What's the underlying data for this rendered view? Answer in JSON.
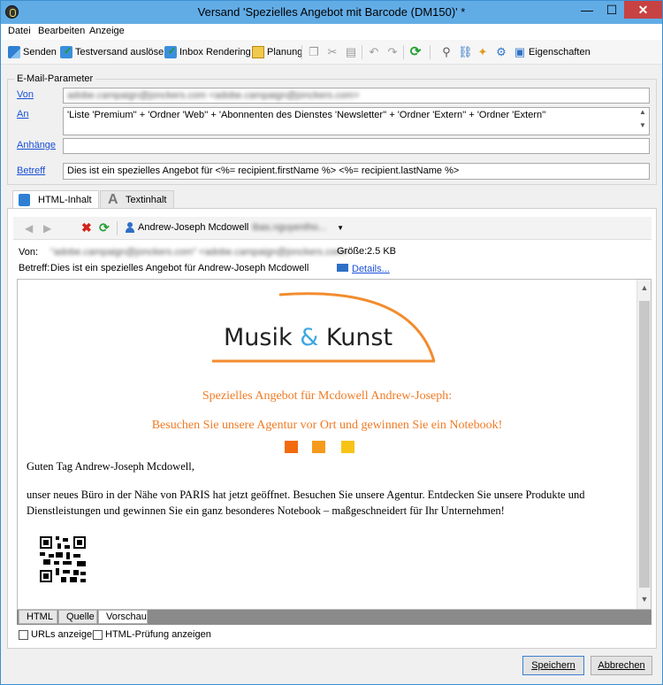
{
  "window": {
    "title": "Versand 'Spezielles Angebot mit Barcode (DM150)' *"
  },
  "menu": [
    "Datei",
    "Bearbeiten",
    "Anzeige"
  ],
  "toolbar": {
    "send": "Senden",
    "test_send": "Testversand auslösen",
    "inbox_rendering": "Inbox Rendering",
    "planning": "Planung",
    "properties": "Eigenschaften"
  },
  "params": {
    "group_title": "E-Mail-Parameter",
    "from_label": "Von",
    "from_value": "adobe.campaign@jonckers.com   <adobe.campaign@jonckers.com>",
    "to_label": "An",
    "to_value": "'Liste 'Premium'' + 'Ordner 'Web'' + 'Abonnenten des Dienstes 'Newsletter'' + 'Ordner 'Extern'' + 'Ordner 'Extern''",
    "attachments_label": "Anhänge",
    "attachments_value": "",
    "subject_label": "Betreff",
    "subject_value": "Dies ist ein spezielles Angebot für <%= recipient.firstName %> <%= recipient.lastName %>"
  },
  "content_tabs": {
    "html": "HTML-Inhalt",
    "text": "Textinhalt"
  },
  "preview": {
    "recipient_name": "Andrew-Joseph Mcdowell",
    "recipient_email": "ibas.nguyentho...",
    "from_label": "Von:",
    "from_value": "\"adobe.campaign@jonckers.com\"   <adobe.campaign@jonckers.com>",
    "subject_label": "Betreff:",
    "subject_value": "Dies ist ein spezielles Angebot für Andrew-Joseph Mcdowell",
    "size_label": "Größe:",
    "size_value": "2.5 KB",
    "details_link": "Details..."
  },
  "email": {
    "logo_text_1": "Musik ",
    "logo_amp": "&",
    "logo_text_2": " Kunst",
    "offer_title": "Spezielles Angebot für Mcdowell Andrew-Joseph:",
    "offer_sub": "Besuchen Sie unsere Agentur vor Ort und gewinnen Sie ein Notebook!",
    "greeting": "Guten Tag Andrew-Joseph Mcdowell,",
    "body": "unser neues Büro in der Nähe von PARIS hat jetzt geöffnet. Besuchen Sie unsere Agentur. Entdecken Sie unsere Produkte und Dienstleistungen und gewinnen Sie ein ganz besonderes Notebook – maßgeschneidert für Ihr Unternehmen!"
  },
  "bottom_tabs": [
    "HTML",
    "Quelle",
    "Vorschau"
  ],
  "options": {
    "show_urls": "URLs anzeigen",
    "show_html_check": "HTML-Prüfung anzeigen"
  },
  "buttons": {
    "save": "Speichern",
    "cancel": "Abbrechen"
  },
  "colors": {
    "accent_orange": "#f07a24",
    "square_1": "#f26a10",
    "square_2": "#f79a1c",
    "square_3": "#f7c316",
    "link_blue": "#1a4fd8",
    "titlebar": "#62ace6"
  }
}
